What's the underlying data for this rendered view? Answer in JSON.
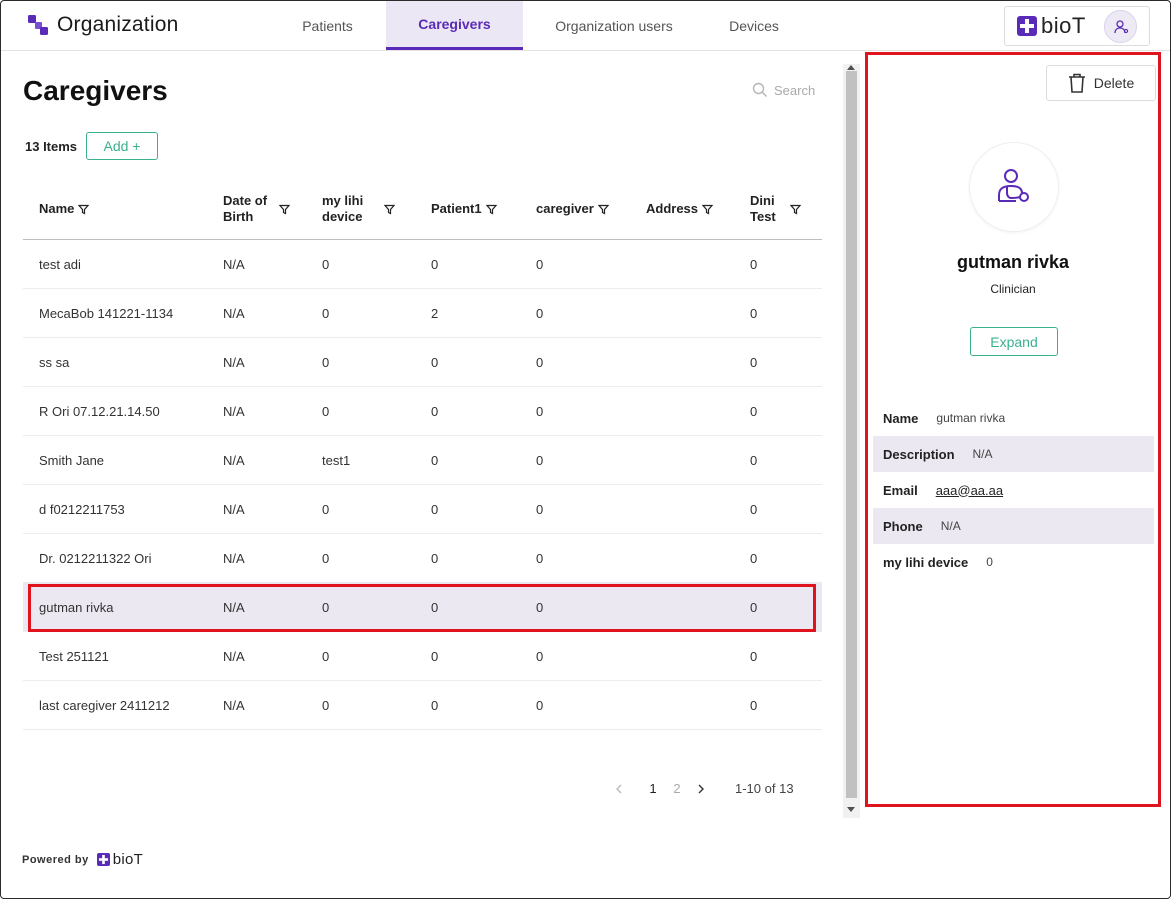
{
  "app": {
    "title": "Organization",
    "brand": "bioT",
    "colors": {
      "accent": "#5a2bb8",
      "green": "#3bb08f",
      "highlight": "#e0141e",
      "selected_row": "#ebe8f2"
    }
  },
  "nav": {
    "tabs": [
      {
        "label": "Patients",
        "active": false
      },
      {
        "label": "Caregivers",
        "active": true
      },
      {
        "label": "Organization users",
        "active": false
      },
      {
        "label": "Devices",
        "active": false
      }
    ]
  },
  "main": {
    "title": "Caregivers",
    "search_placeholder": "Search",
    "items_count": "13 Items",
    "add_label": "Add +"
  },
  "table": {
    "columns": [
      "Name",
      "Date of Birth",
      "my lihi device",
      "Patient1",
      "caregiver",
      "Address",
      "Dini Test"
    ],
    "rows": [
      [
        "test adi",
        "N/A",
        "0",
        "0",
        "0",
        "",
        "0"
      ],
      [
        "MecaBob 141221-1134",
        "N/A",
        "0",
        "2",
        "0",
        "",
        "0"
      ],
      [
        "ss sa",
        "N/A",
        "0",
        "0",
        "0",
        "",
        "0"
      ],
      [
        "R Ori 07.12.21.14.50",
        "N/A",
        "0",
        "0",
        "0",
        "",
        "0"
      ],
      [
        "Smith Jane",
        "N/A",
        "test1",
        "0",
        "0",
        "",
        "0"
      ],
      [
        "d f0212211753",
        "N/A",
        "0",
        "0",
        "0",
        "",
        "0"
      ],
      [
        "Dr. 0212211322 Ori",
        "N/A",
        "0",
        "0",
        "0",
        "",
        "0"
      ],
      [
        "gutman rivka",
        "N/A",
        "0",
        "0",
        "0",
        "",
        "0"
      ],
      [
        "Test 251121",
        "N/A",
        "0",
        "0",
        "0",
        "",
        "0"
      ],
      [
        "last caregiver 2411212",
        "N/A",
        "0",
        "0",
        "0",
        "",
        "0"
      ]
    ],
    "selected_row": 7
  },
  "pagination": {
    "pages": [
      "1",
      "2"
    ],
    "current": "1",
    "range": "1-10 of 13"
  },
  "footer": {
    "powered_by": "Powered by",
    "brand": "bioT"
  },
  "panel": {
    "delete_label": "Delete",
    "name": "gutman rivka",
    "role": "Clinician",
    "expand_label": "Expand",
    "details": [
      {
        "label": "Name",
        "value": "gutman rivka",
        "link": false
      },
      {
        "label": "Description",
        "value": "N/A",
        "link": false
      },
      {
        "label": "Email",
        "value": "aaa@aa.aa",
        "link": true
      },
      {
        "label": "Phone",
        "value": "N/A",
        "link": false
      },
      {
        "label": "my lihi device",
        "value": "0",
        "link": false
      }
    ]
  }
}
